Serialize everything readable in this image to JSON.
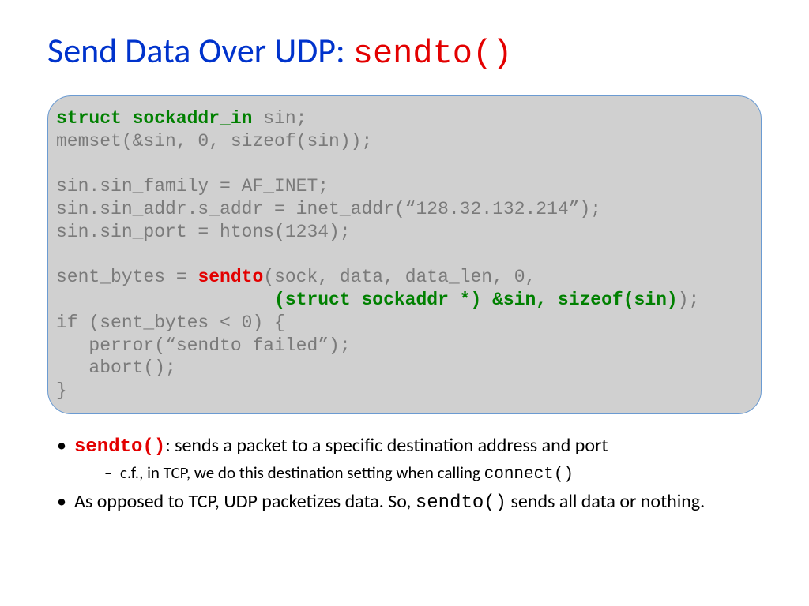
{
  "title": {
    "part1": "Send Data Over UDP: ",
    "part2": "sendto()"
  },
  "code": {
    "l1a": "struct sockaddr_in",
    "l1b": " sin;",
    "l2": "memset(&sin, 0, sizeof(sin));",
    "l3": "",
    "l4": "sin.sin_family = AF_INET;",
    "l5": "sin.sin_addr.s_addr = inet_addr(“128.32.132.214”);",
    "l6": "sin.sin_port = htons(1234);",
    "l7": "",
    "l8a": "sent_bytes = ",
    "l8b": "sendto",
    "l8c": "(sock, data, data_len, 0,",
    "l9a": "                    ",
    "l9b": "(struct sockaddr *) &sin, sizeof(sin)",
    "l9c": ");",
    "l10": "if (sent_bytes < 0) {",
    "l11": "   perror(“sendto failed”);",
    "l12": "   abort();",
    "l13": "}"
  },
  "bullets": {
    "b1a": "sendto()",
    "b1b": ": sends a packet to a specific destination address and port",
    "b1sub_a": "c.f., in TCP, we do this destination setting when calling ",
    "b1sub_b": "connect()",
    "b2a": "As opposed to TCP, UDP packetizes data. So, ",
    "b2b": "sendto()",
    "b2c": " sends all data or nothing."
  }
}
